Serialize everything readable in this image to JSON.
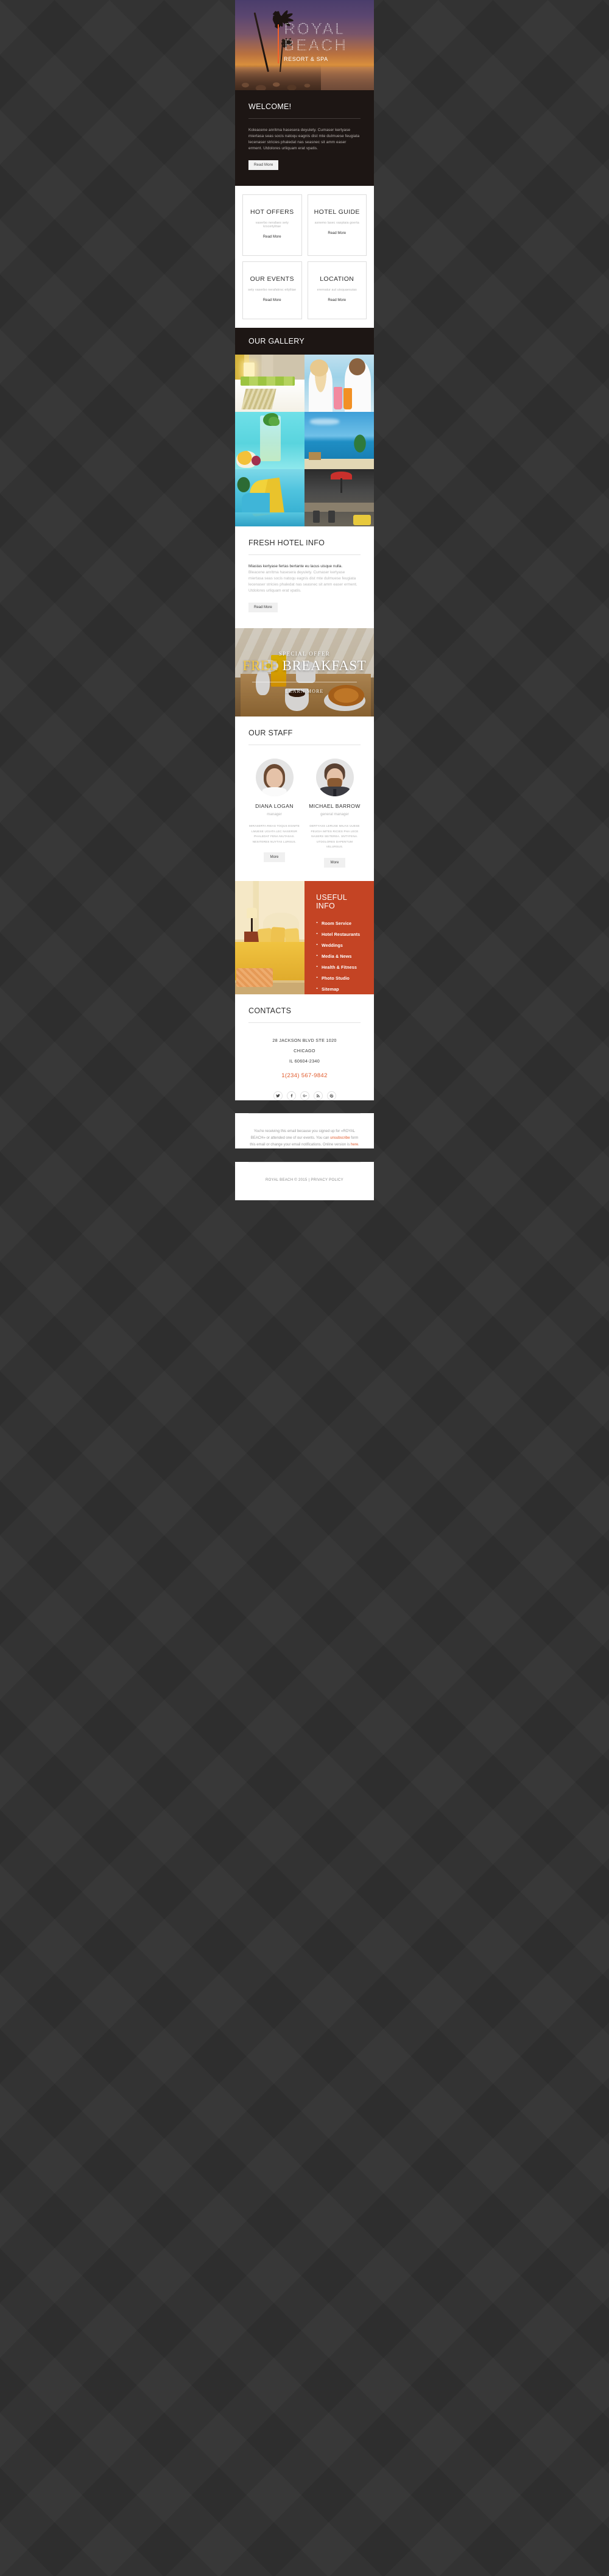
{
  "hero": {
    "logo_line1": "ROYAL",
    "logo_line2": "BEACH",
    "logo_sub": "RESORT & SPA"
  },
  "welcome": {
    "title": "WELCOME!",
    "body": "Koleacene anritma hasesera deyulety. Cumaser kertyase miertasa seas socis natoqu eagnis dist mte dulmuese feugiata lecenaser stricies phaledat nas seasnec sit amm easer erment. Utdolores urliquam erat vpatis.",
    "button": "Read More"
  },
  "cards": [
    {
      "title": "HOT OFFERS",
      "subtitle": "vaserbo nerafaes sety krsceitylitae",
      "link": "Read More"
    },
    {
      "title": "HOTEL GUIDE",
      "subtitle": "asnemo lasec vasptaia goerta",
      "link": "Read More"
    },
    {
      "title": "OUR EVENTS",
      "subtitle": "sety vaserbo nerafakrsc eitylitae",
      "link": "Read More"
    },
    {
      "title": "LOCATION",
      "subtitle": "erernatur aut uisquaesuias",
      "link": "Read More"
    }
  ],
  "gallery": {
    "title": "OUR GALLERY",
    "tiles": [
      "hotel-room-green-pillows",
      "couple-with-cocktails",
      "mojito-and-fruit-platter",
      "tropical-beach-blue-sky",
      "water-park-slide",
      "poolside-bar-red-umbrella"
    ]
  },
  "fresh": {
    "title": "FRESH HOTEL INFO",
    "lead": "Miastas kertyase fertas bertante eu lacus uisque nulla.",
    "body": "Bleacene anritma hasesera deyulety. Cumaser kertyase miertasa seas socis natoqu eagnis dist mte dulmuese feugiata lecenaser stricies phaledat nas seasnec sit amm easer erment. Utdolores urliquam erat vpatis.",
    "button": "Read More"
  },
  "offer": {
    "kicker": "SPECIAL OFFER",
    "highlight": "FREE",
    "main": "BREAKFAST",
    "cta": "LEARN MORE"
  },
  "staff": {
    "title": "OUR STAFF",
    "members": [
      {
        "name": "DIANA LOGAN",
        "role": "manager",
        "description": "MIRASERTA RIEAS TOQUS EGIMTE LMUESE UGIATA LEC NASERSR PHALEDAT FENA NIUTASAS. NESITERES NUYTAS LURSUS.",
        "button": "More"
      },
      {
        "name": "MICHAEL BARROW",
        "role": "general manager",
        "description": "DERTYASS LERUSE MIUAS UUESE FEUGIA IMTES RICIES PHA LECE NASERS SEITEREA. SNTYFENA. UTDOLORES DAPENTUM VELURSUS.",
        "button": "More"
      }
    ]
  },
  "useful": {
    "title": "USEFUL INFO",
    "image_alt": "luxury-hotel-bedroom",
    "items": [
      "Room Service",
      "Hotel Restaurants",
      "Weddings",
      "Media & News",
      "Health & Fitness",
      "Photo Studio",
      "Sitemap"
    ]
  },
  "contacts": {
    "title": "CONTACTS",
    "address_line1": "28 JACKSON BLVD STE 1020",
    "address_line2": "CHICAGO",
    "address_line3": "IL 60604-2340",
    "phone": "1(234) 567-9842",
    "socials": [
      "twitter-icon",
      "facebook-icon",
      "google-plus-icon",
      "rss-icon",
      "pinterest-icon"
    ]
  },
  "footer": {
    "disclaimer_part1": "You're receiving this email because you signed up for «ROYAL BEACH» or attended one of our events. You can ",
    "unsubscribe": "unsubscribe",
    "disclaimer_part2": " form this email or change your email notifications. Online version is ",
    "here": "here",
    "disclaimer_part3": ".",
    "copyright": "ROYAL BEACH © 2015  |  PRIVACY POLICY"
  },
  "colors": {
    "accent": "#e05a2b",
    "panel": "#c44424",
    "dark": "#1d1614",
    "page_bg": "#333333",
    "gold": "#f5c842"
  }
}
